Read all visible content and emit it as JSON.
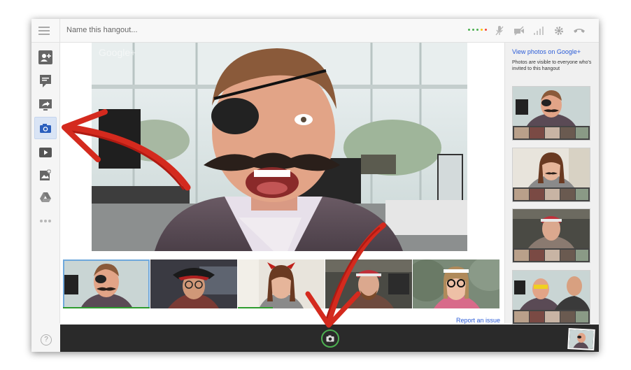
{
  "hangout": {
    "name_placeholder": "Name this hangout...",
    "watermark": "Google+"
  },
  "toolbar": {
    "signal_dots": [
      "#4caf50",
      "#4caf50",
      "#4caf50",
      "#ffc107",
      "#f44336"
    ],
    "icons": [
      "mute-mic-icon",
      "mute-video-icon",
      "bandwidth-icon",
      "settings-icon",
      "hang-up-icon"
    ]
  },
  "sidebar": {
    "items": [
      {
        "icon": "invite-people-icon",
        "active": false
      },
      {
        "icon": "chat-icon",
        "active": false
      },
      {
        "icon": "screenshare-icon",
        "active": false
      },
      {
        "icon": "camera-icon",
        "active": true
      },
      {
        "icon": "youtube-icon",
        "active": false
      },
      {
        "icon": "effects-icon",
        "active": false
      },
      {
        "icon": "google-drive-icon",
        "active": false
      },
      {
        "icon": "more-apps-icon",
        "active": false
      }
    ],
    "help_label": "?"
  },
  "participants": [
    {
      "label": "participant-1",
      "speaking": true,
      "active": true
    },
    {
      "label": "participant-2",
      "speaking": false,
      "active": false
    },
    {
      "label": "participant-3",
      "speaking": true,
      "active": false
    },
    {
      "label": "participant-4",
      "speaking": false,
      "active": false
    },
    {
      "label": "participant-5",
      "speaking": false,
      "active": false
    }
  ],
  "footer": {
    "report_issue": "Report an issue"
  },
  "right_panel": {
    "view_photos_link": "View photos on Google+",
    "privacy_note": "Photos are visible to everyone who's invited to this hangout"
  },
  "colors": {
    "accent_blue": "#2a5bd7",
    "speaking_green": "#2e9c2e",
    "snapshot_ring": "#4caf50",
    "annotation_red": "#d42a1e"
  }
}
